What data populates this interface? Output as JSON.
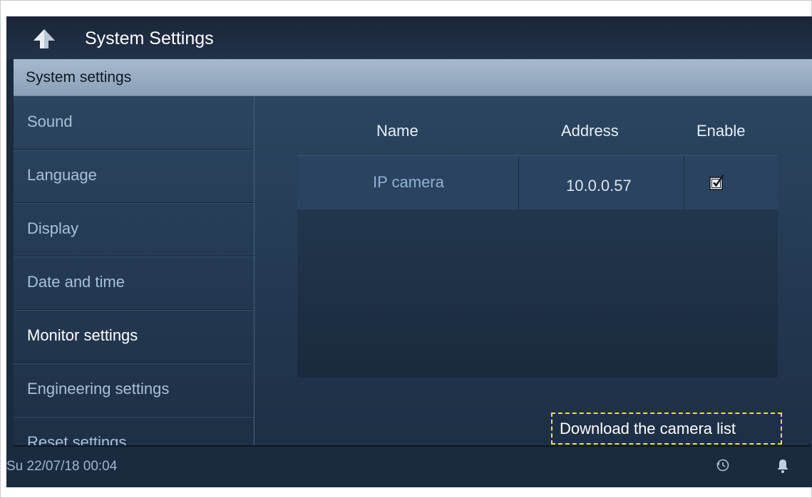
{
  "header": {
    "title": "System Settings",
    "back_icon": "back-arrow-icon"
  },
  "section": {
    "title": "System settings"
  },
  "sidebar": {
    "items": [
      {
        "label": "Sound",
        "active": false
      },
      {
        "label": "Language",
        "active": false
      },
      {
        "label": "Display",
        "active": false
      },
      {
        "label": "Date and time",
        "active": false
      },
      {
        "label": "Monitor settings",
        "active": true
      },
      {
        "label": "Engineering settings",
        "active": false
      },
      {
        "label": "Reset settings",
        "active": false
      }
    ]
  },
  "table": {
    "columns": {
      "name": "Name",
      "address": "Address",
      "enable": "Enable"
    },
    "rows": [
      {
        "name": "IP camera",
        "address": "10.0.0.57",
        "enabled": true
      }
    ]
  },
  "download_button": {
    "label": "Download the camera list"
  },
  "status": {
    "datetime": "Su 22/07/18  00:04",
    "icons": [
      "history-icon",
      "bell-icon"
    ]
  },
  "colors": {
    "background": "#1b2b3f",
    "section_header": "#9cb0c6",
    "highlight_border": "#f0e330"
  }
}
